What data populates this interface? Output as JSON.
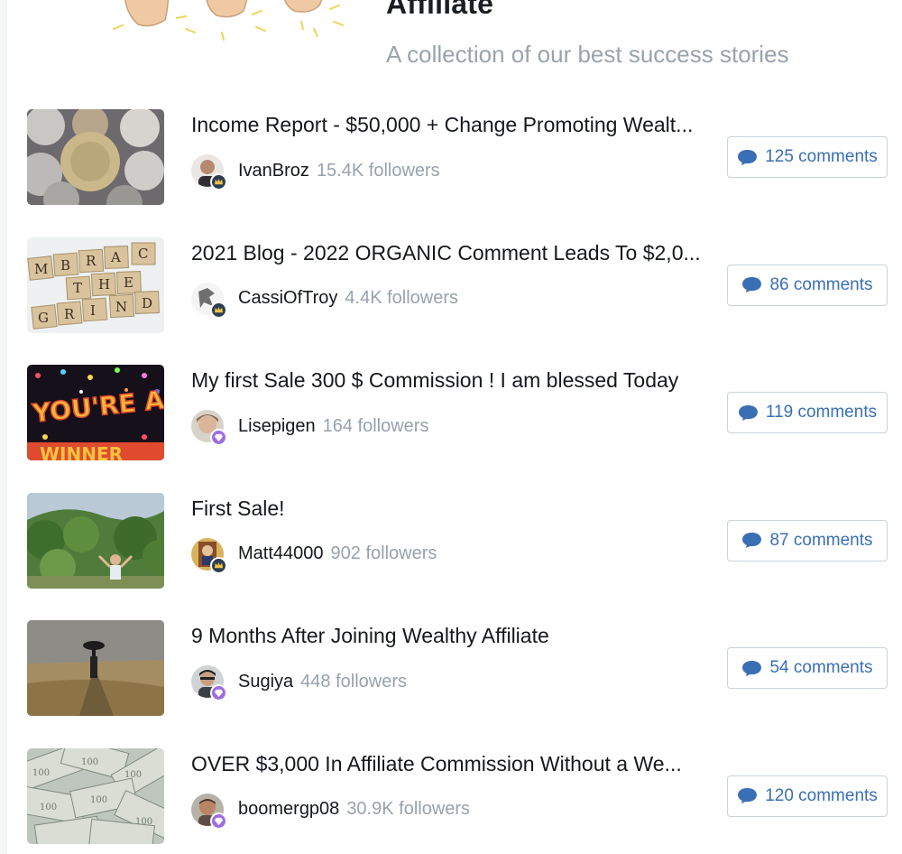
{
  "header": {
    "title": "Affiliate",
    "subtitle": "A collection of our best success stories"
  },
  "colors": {
    "title": "#1b1f23",
    "subtitle": "#9aa3ad",
    "comment_accent": "#3a6fb5",
    "rank_crown_bg": "#2d3e50",
    "rank_crown_fg": "#f3c34b",
    "rank_premium_bg": "#9b6ee6"
  },
  "posts": [
    {
      "title": "Income Report - $50,000 + Change Promoting Wealt...",
      "author": "IvanBroz",
      "followers": "15.4K followers",
      "comments": "125 comments",
      "rank_icon": "crown-icon",
      "thumb": "coins-image"
    },
    {
      "title": "2021 Blog - 2022 ORGANIC Comment Leads To $2,0...",
      "author": "CassiOfTroy",
      "followers": "4.4K followers",
      "comments": "86 comments",
      "rank_icon": "crown-icon",
      "thumb": "scrabble-tiles-image"
    },
    {
      "title": "My first Sale 300 $ Commission ! I am blessed Today",
      "author": "Lisepigen",
      "followers": "164 followers",
      "comments": "119 comments",
      "rank_icon": "diamond-icon",
      "thumb": "youre-a-winner-image"
    },
    {
      "title": "First Sale!",
      "author": "Matt44000",
      "followers": "902 followers",
      "comments": "87 comments",
      "rank_icon": "crown-icon",
      "thumb": "celebrating-man-image"
    },
    {
      "title": "9 Months After Joining Wealthy Affiliate",
      "author": "Sugiya",
      "followers": "448 followers",
      "comments": "54 comments",
      "rank_icon": "diamond-icon",
      "thumb": "umbrella-field-image"
    },
    {
      "title": "OVER $3,000 In Affiliate Commission Without a We...",
      "author": "boomergp08",
      "followers": "30.9K followers",
      "comments": "120 comments",
      "rank_icon": "diamond-icon",
      "thumb": "dollar-bills-image"
    }
  ]
}
